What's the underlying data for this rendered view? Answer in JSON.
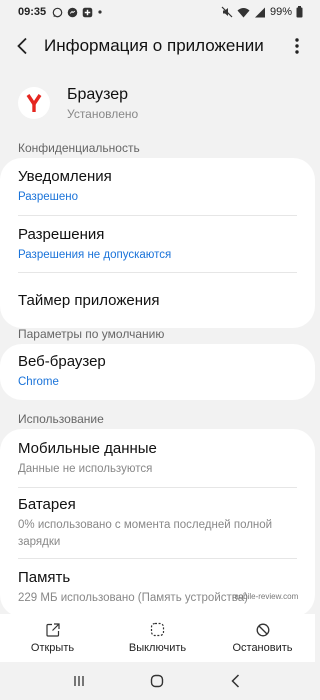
{
  "status_bar": {
    "time": "09:35",
    "battery": "99%"
  },
  "app_bar": {
    "title": "Информация о приложении"
  },
  "app": {
    "name": "Браузер",
    "status": "Установлено"
  },
  "sections": {
    "privacy": "Конфиденциальность",
    "defaults": "Параметры по умолчанию",
    "usage": "Использование"
  },
  "privacy_items": [
    {
      "title": "Уведомления",
      "subtitle": "Разрешено"
    },
    {
      "title": "Разрешения",
      "subtitle": "Разрешения не допускаются"
    },
    {
      "title": "Таймер приложения"
    }
  ],
  "default_items": [
    {
      "title": "Веб-браузер",
      "subtitle": "Chrome"
    }
  ],
  "usage_items": [
    {
      "title": "Мобильные данные",
      "subtitle": "Данные не используются"
    },
    {
      "title": "Батарея",
      "subtitle": "0% использовано с момента последней полной зарядки"
    },
    {
      "title": "Память",
      "subtitle": "229 МБ использовано (Память устройства)"
    }
  ],
  "bottom_actions": {
    "open": "Открыть",
    "disable": "Выключить",
    "stop": "Остановить"
  },
  "watermark": "mobile-review.com",
  "colors": {
    "accent_blue": "#1a73d9",
    "app_icon_red": "#e52620",
    "background": "#f2f2f2"
  },
  "icons": {
    "back": "back-arrow-icon",
    "more": "more-vertical-icon",
    "open": "open-external-icon",
    "disable": "disable-icon",
    "stop": "stop-icon"
  }
}
